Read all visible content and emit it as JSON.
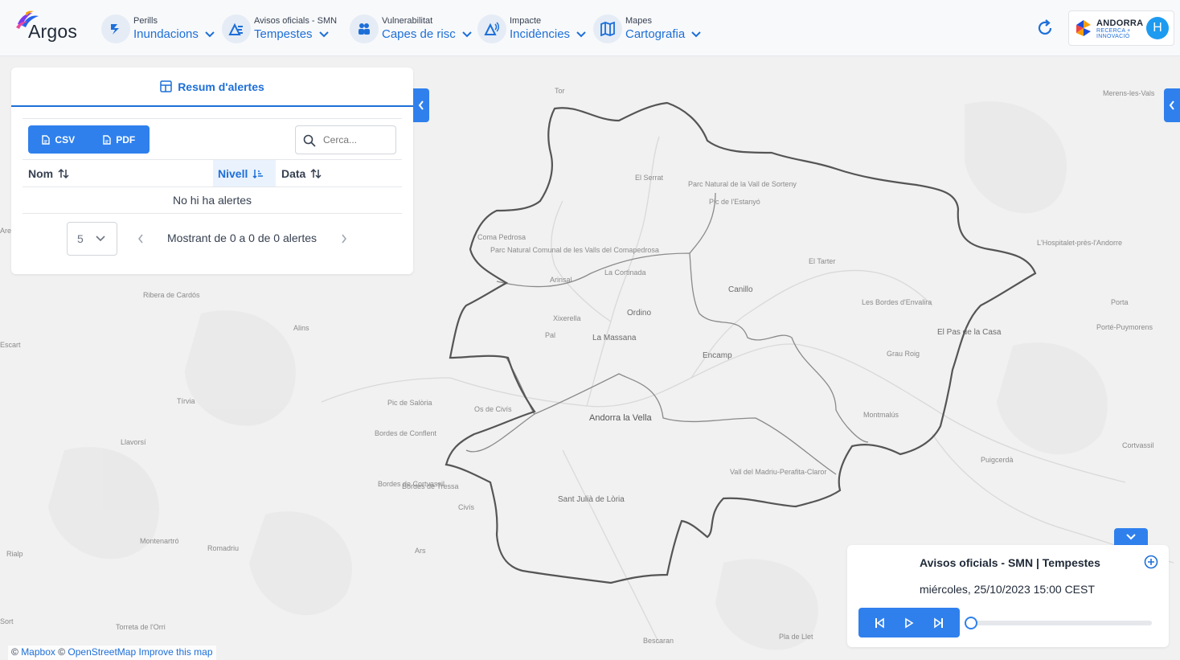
{
  "header": {
    "logo_text": "Argos",
    "nav": [
      {
        "small": "Perills",
        "main": "Inundacions",
        "icon": "flood-icon"
      },
      {
        "small": "Avisos oficials - SMN",
        "main": "Tempestes",
        "icon": "storm-warning-icon"
      },
      {
        "small": "Vulnerabilitat",
        "main": "Capes de risc",
        "icon": "people-icon"
      },
      {
        "small": "Impacte",
        "main": "Incidències",
        "icon": "alert-signal-icon"
      },
      {
        "small": "Mapes",
        "main": "Cartografia",
        "icon": "map-icon"
      }
    ],
    "partner": {
      "title": "ANDORRA",
      "sub1": "RECERCA +",
      "sub2": "INNOVACIÓ"
    },
    "avatar_initial": "H"
  },
  "alerts_panel": {
    "tab_label": "Resum d'alertes",
    "csv_label": "CSV",
    "pdf_label": "PDF",
    "search_placeholder": "Cerca...",
    "columns": [
      "Nom",
      "Nivell",
      "Data"
    ],
    "sorted_column": "Nivell",
    "empty_text": "No hi ha alertes",
    "rows_per_page": "5",
    "pagination_text": "Mostrant de 0 a 0 de 0 alertes"
  },
  "time_panel": {
    "title": "Avisos oficials - SMN | Tempestes",
    "datetime": "miércoles, 25/10/2023 15:00 CEST",
    "slider_position": 0
  },
  "map": {
    "places": [
      {
        "name": "Canillo",
        "cls": "big"
      },
      {
        "name": "Ordino",
        "cls": "big"
      },
      {
        "name": "La Massana",
        "cls": "big"
      },
      {
        "name": "Encamp",
        "cls": "big"
      },
      {
        "name": "Andorra la Vella",
        "cls": "major"
      },
      {
        "name": "Sant Julià de Lòria",
        "cls": "big"
      },
      {
        "name": "El Pas de la Casa",
        "cls": "big"
      },
      {
        "name": "El Tarter",
        "cls": ""
      },
      {
        "name": "Pic de l'Estanyó",
        "cls": ""
      },
      {
        "name": "Parc Natural de la Vall de Sorteny",
        "cls": ""
      },
      {
        "name": "El Serrat",
        "cls": ""
      },
      {
        "name": "Coma Pedrosa",
        "cls": ""
      },
      {
        "name": "Parc Natural Comunal de les Valls del Comapedrosa",
        "cls": ""
      },
      {
        "name": "Arinsal",
        "cls": ""
      },
      {
        "name": "La Cortinada",
        "cls": ""
      },
      {
        "name": "Xixerella",
        "cls": ""
      },
      {
        "name": "Pal",
        "cls": ""
      },
      {
        "name": "Les Bordes d'Envalira",
        "cls": ""
      },
      {
        "name": "Grau Roig",
        "cls": ""
      },
      {
        "name": "Montmalús",
        "cls": ""
      },
      {
        "name": "Vall del Madriu-Perafita-Claror",
        "cls": ""
      },
      {
        "name": "Pic de Salòria",
        "cls": ""
      },
      {
        "name": "Os de Civís",
        "cls": ""
      },
      {
        "name": "Bordes de Conflent",
        "cls": ""
      },
      {
        "name": "Bordes de Tressa",
        "cls": ""
      },
      {
        "name": "Bordes de Cortvassil",
        "cls": ""
      },
      {
        "name": "Civís",
        "cls": ""
      },
      {
        "name": "Ribera de Cardós",
        "cls": ""
      },
      {
        "name": "Alins",
        "cls": ""
      },
      {
        "name": "Tírvia",
        "cls": ""
      },
      {
        "name": "Llavorsí",
        "cls": ""
      },
      {
        "name": "Rialp",
        "cls": ""
      },
      {
        "name": "Montenartró",
        "cls": ""
      },
      {
        "name": "Romadriu",
        "cls": ""
      },
      {
        "name": "Ars",
        "cls": ""
      },
      {
        "name": "Porté-Puymorens",
        "cls": ""
      },
      {
        "name": "Porta",
        "cls": ""
      },
      {
        "name": "Puigcerdà",
        "cls": ""
      },
      {
        "name": "Cortvassil",
        "cls": ""
      },
      {
        "name": "L'Hospitalet-près-l'Andorre",
        "cls": ""
      },
      {
        "name": "Merens-les-Vals",
        "cls": ""
      },
      {
        "name": "Torreta de l'Orri",
        "cls": ""
      },
      {
        "name": "Bescaran",
        "cls": ""
      },
      {
        "name": "Pla de Llet",
        "cls": ""
      },
      {
        "name": "Sort",
        "cls": ""
      },
      {
        "name": "Escart",
        "cls": ""
      },
      {
        "name": "Areu",
        "cls": ""
      },
      {
        "name": "Tor",
        "cls": ""
      }
    ]
  },
  "attribution": {
    "copy1": "©",
    "mapbox": "Mapbox",
    "copy2": "©",
    "osm": "OpenStreetMap",
    "improve": "Improve this map"
  }
}
